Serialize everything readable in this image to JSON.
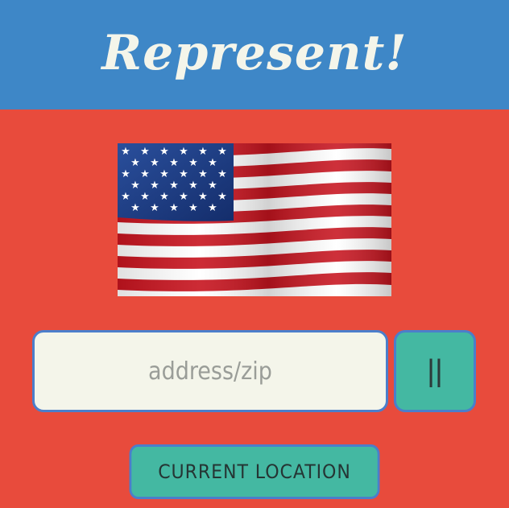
{
  "header": {
    "title": "Represent!"
  },
  "flag": {
    "icon": "us-flag-icon"
  },
  "search": {
    "placeholder": "address/zip",
    "value": "",
    "submit_label": "||"
  },
  "actions": {
    "current_location_label": "CURRENT LOCATION"
  },
  "colors": {
    "header_bg": "#3e87c7",
    "page_bg": "#e84b3c",
    "button_bg": "#44b8a2",
    "input_bg": "#f4f5ea",
    "border": "#4b7ecb"
  }
}
